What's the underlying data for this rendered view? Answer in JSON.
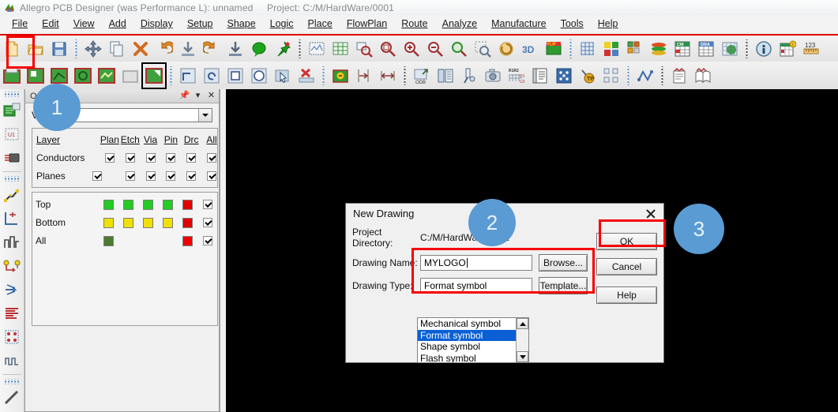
{
  "window": {
    "title": "Allegro PCB Designer (was Performance L): unnamed",
    "project": "Project: C:/M/HardWare/0001",
    "logo_icon": "allegro-logo-icon"
  },
  "menubar": {
    "items": [
      {
        "label": "File"
      },
      {
        "label": "Edit"
      },
      {
        "label": "View"
      },
      {
        "label": "Add"
      },
      {
        "label": "Display"
      },
      {
        "label": "Setup"
      },
      {
        "label": "Shape"
      },
      {
        "label": "Logic"
      },
      {
        "label": "Place"
      },
      {
        "label": "FlowPlan"
      },
      {
        "label": "Route"
      },
      {
        "label": "Analyze"
      },
      {
        "label": "Manufacture"
      },
      {
        "label": "Tools"
      },
      {
        "label": "Help"
      }
    ]
  },
  "toolbar_row1": {
    "icons": [
      "new-file-icon",
      "open-folder-icon",
      "save-icon",
      "sep",
      "move-icon",
      "copy-icon",
      "delete-x-icon",
      "undo-icon",
      "import-down-icon",
      "redo-icon",
      "export-down-icon",
      "comment-balloon-icon",
      "pin-icon",
      "sep",
      "zoom-fit-world-icon",
      "zoom-grid-icon",
      "zoom-by-points-icon",
      "zoom-region-icon",
      "zoom-in-icon",
      "zoom-out-icon",
      "zoom-center-icon",
      "zoom-selection-icon",
      "refresh-icon",
      "3d-view-icon",
      "flip-design-icon",
      "sep",
      "grid-toggle-icon",
      "color-palette-icon",
      "subclass-visibility-icon",
      "layer-stack-icon",
      "constraint-manager-icon",
      "drawing-params-icon",
      "globe-grid-icon",
      "sep",
      "status-info-icon",
      "db-check-icon",
      "measure-ruler-icon"
    ]
  },
  "toolbar_row2": {
    "icons": [
      "shape-add-rect-icon",
      "shape-select-icon",
      "shape-edit-icon",
      "shape-void-icon",
      "shape-merge-icon",
      "shape-disabled-icon",
      "shape-active-icon",
      "sep",
      "line-corner-icon",
      "rectangle-icon",
      "circle-icon",
      "arrow-select-icon",
      "fillet-icon",
      "rotate-icon",
      "square-icon",
      "target-icon",
      "slot-icon",
      "delete-stack-icon",
      "sep",
      "drill-legend-icon",
      "dimension-left-icon",
      "dimension-both-icon",
      "sep",
      "odb-export-icon",
      "film-control-icon",
      "probe-icon",
      "camera-snapshot-icon",
      "rename-refdes-icon",
      "report-list-icon",
      "padstack-grid-icon",
      "testpoint-icon",
      "components-grid-icon",
      "sep",
      "signal-waveform-icon",
      "sep",
      "report-sheet-icon",
      "open-book-icon"
    ]
  },
  "rail": {
    "items": [
      "grip",
      "board-geometry-icon",
      "symbol-unit-icon",
      "component-icon",
      "separator",
      "grip",
      "route-net-icon",
      "placement-icon",
      "signal-steps-icon",
      "pin-to-pin-icon",
      "fanout-icon",
      "netlist-lines-icon",
      "via-matrix-icon",
      "serpentine-icon",
      "separator",
      "grip",
      "line-draw-icon"
    ]
  },
  "options_panel": {
    "title": "Options",
    "pin_icon": "pin-icon",
    "menu_icon": "chevron-down-icon",
    "close_icon": "close-icon",
    "view_label": "View",
    "view_value": "",
    "table": {
      "row_header": "Layer",
      "columns": [
        "Plan",
        "Etch",
        "Via",
        "Pin",
        "Drc",
        "All"
      ],
      "rows": [
        {
          "name": "Conductors",
          "checks": [
            true,
            true,
            true,
            true,
            true,
            true
          ]
        },
        {
          "name": "Planes",
          "checks": [
            true,
            false,
            true,
            true,
            true,
            true,
            true
          ]
        }
      ]
    },
    "layers": [
      {
        "name": "Top",
        "swatches": [
          "#22cc22",
          "#22cc22",
          "#22cc22",
          "#22cc22",
          "#e00000"
        ],
        "checked": true
      },
      {
        "name": "Bottom",
        "swatches": [
          "#f0e000",
          "#f0e000",
          "#f0e000",
          "#f0e000",
          "#e00000"
        ],
        "checked": true
      },
      {
        "name": "All",
        "swatches": [
          "#4c7a30",
          "",
          "",
          "",
          "#f00000"
        ],
        "checked": true
      }
    ]
  },
  "dialog": {
    "title": "New Drawing",
    "close_icon": "close-icon",
    "project_directory_label": "Project Directory:",
    "project_directory_value": "C:/M/HardWare/0001",
    "drawing_name_label": "Drawing Name:",
    "drawing_name_value": "MYLOGO",
    "drawing_type_label": "Drawing Type:",
    "drawing_type_value": "Format symbol",
    "browse_label": "Browse...",
    "template_label": "Template...",
    "ok_label": "OK",
    "cancel_label": "Cancel",
    "help_label": "Help",
    "type_options": [
      {
        "label": "Mechanical symbol",
        "selected": false
      },
      {
        "label": "Format symbol",
        "selected": true
      },
      {
        "label": "Shape symbol",
        "selected": false
      },
      {
        "label": "Flash symbol",
        "selected": false
      }
    ],
    "scroll_up_icon": "triangle-up-icon",
    "scroll_down_icon": "triangle-down-icon"
  },
  "annotations": {
    "badges": [
      {
        "number": "1"
      },
      {
        "number": "2"
      },
      {
        "number": "3"
      }
    ],
    "badge_color": "#5a9bd4",
    "highlight_color": "#f60000"
  }
}
